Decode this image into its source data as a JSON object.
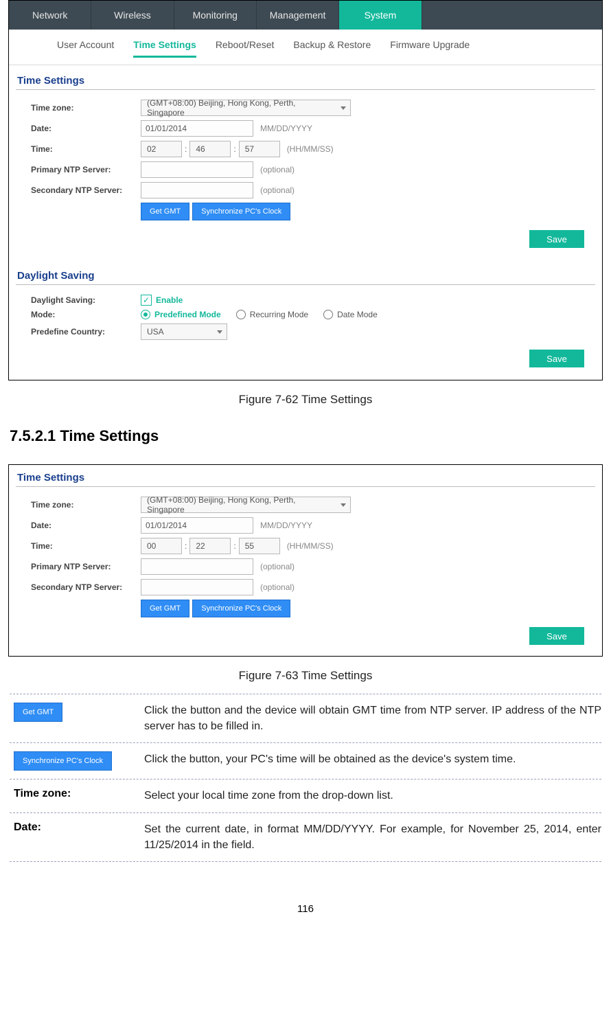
{
  "main_nav": {
    "items": [
      "Network",
      "Wireless",
      "Monitoring",
      "Management",
      "System"
    ],
    "active": "System"
  },
  "sub_nav": {
    "items": [
      "User Account",
      "Time Settings",
      "Reboot/Reset",
      "Backup & Restore",
      "Firmware Upgrade"
    ],
    "active": "Time Settings"
  },
  "fig1": {
    "section1_title": "Time Settings",
    "tz_label": "Time zone:",
    "tz_value": "(GMT+08:00) Beijing, Hong Kong, Perth, Singapore",
    "date_label": "Date:",
    "date_value": "01/01/2014",
    "date_hint": "MM/DD/YYYY",
    "time_label": "Time:",
    "time_hh": "02",
    "time_mm": "46",
    "time_ss": "57",
    "time_hint": "(HH/MM/SS)",
    "pntp_label": "Primary NTP Server:",
    "sntp_label": "Secondary NTP Server:",
    "optional": "(optional)",
    "get_gmt": "Get GMT",
    "sync_pc": "Synchronize PC's Clock",
    "save": "Save",
    "section2_title": "Daylight Saving",
    "ds_label": "Daylight Saving:",
    "enable": "Enable",
    "mode_label": "Mode:",
    "mode_predef": "Predefined Mode",
    "mode_recur": "Recurring Mode",
    "mode_date": "Date Mode",
    "predef_country_label": "Predefine Country:",
    "predef_country_value": "USA"
  },
  "caption1": "Figure 7-62 Time Settings",
  "heading": "7.5.2.1  Time Settings",
  "fig2": {
    "section_title": "Time Settings",
    "tz_label": "Time zone:",
    "tz_value": "(GMT+08:00) Beijing, Hong Kong, Perth, Singapore",
    "date_label": "Date:",
    "date_value": "01/01/2014",
    "date_hint": "MM/DD/YYYY",
    "time_label": "Time:",
    "time_hh": "00",
    "time_mm": "22",
    "time_ss": "55",
    "time_hint": "(HH/MM/SS)",
    "pntp_label": "Primary NTP Server:",
    "sntp_label": "Secondary NTP Server:",
    "optional": "(optional)",
    "get_gmt": "Get GMT",
    "sync_pc": "Synchronize PC's Clock",
    "save": "Save"
  },
  "caption2": "Figure 7-63 Time Settings",
  "desc": {
    "row1_key": "Get GMT",
    "row1_val": "Click the button and the device will obtain GMT time from NTP server. IP address of the NTP server has to be filled in.",
    "row2_key": "Synchronize PC's Clock",
    "row2_val": "Click the button, your PC's time will be obtained as the device's system time.",
    "row3_key": "Time zone:",
    "row3_val": "Select your local time zone from the drop-down list.",
    "row4_key": "Date:",
    "row4_val": "Set the current date, in format MM/DD/YYYY. For example, for November 25, 2014, enter 11/25/2014 in the field."
  },
  "page_number": "116"
}
